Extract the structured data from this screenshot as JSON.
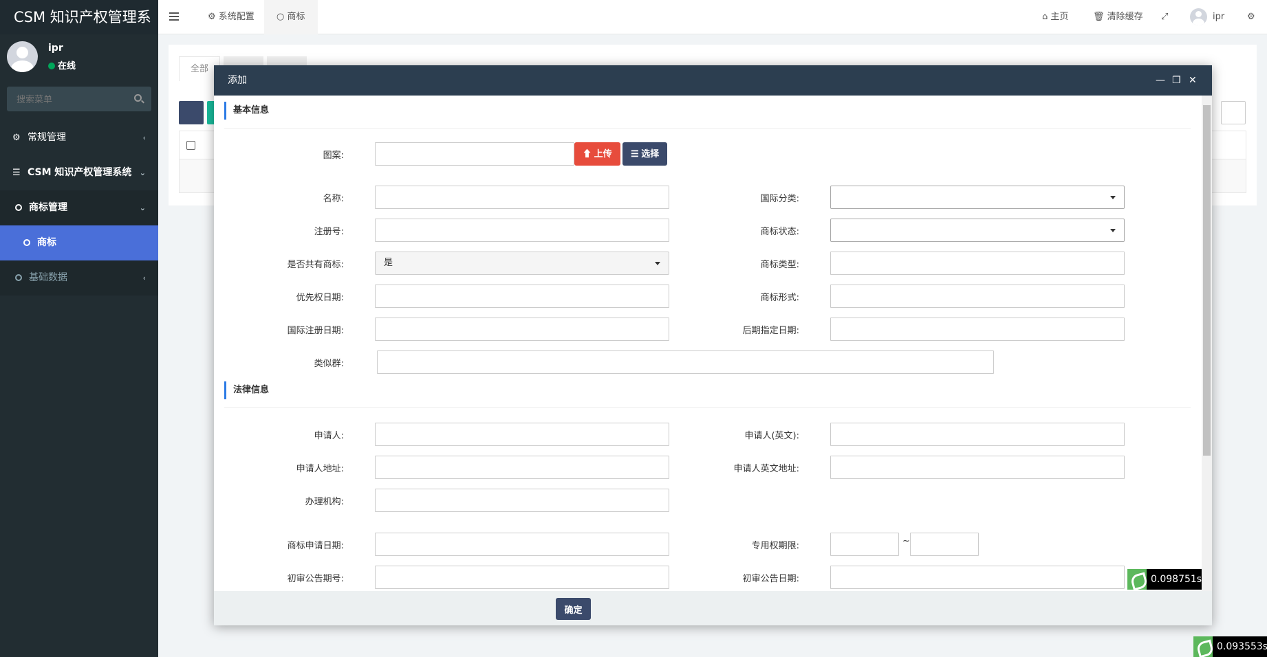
{
  "app": {
    "logo": "CSM 知识产权管理系"
  },
  "user": {
    "name": "ipr",
    "status": "在线"
  },
  "sidebar": {
    "search_placeholder": "搜索菜单",
    "items": [
      {
        "label": "常规管理",
        "icon": "cogs-icon",
        "state": "collapsed"
      },
      {
        "label": "CSM 知识产权管理系统",
        "icon": "list-icon",
        "state": "expanded"
      },
      {
        "label": "商标管理",
        "icon": "circle-icon",
        "state": "expanded"
      },
      {
        "label": "商标",
        "icon": "circle-icon",
        "state": "active"
      },
      {
        "label": "基础数据",
        "icon": "circle-icon",
        "state": "collapsed"
      }
    ]
  },
  "header": {
    "tabs": [
      {
        "label": "系统配置",
        "icon": "gear-icon"
      },
      {
        "label": "商标",
        "icon": "circle-icon"
      }
    ],
    "home": "主页",
    "clear_cache": "清除缓存",
    "user": "ipr"
  },
  "background": {
    "tab_all": "全部"
  },
  "modal": {
    "title": "添加",
    "submit": "确定",
    "sections": {
      "basic": "基本信息",
      "legal": "法律信息"
    },
    "fields": {
      "pattern": "图案:",
      "upload": "上传",
      "choose": "选择",
      "name": "名称:",
      "intl_class": "国际分类:",
      "reg_no": "注册号:",
      "tm_status": "商标状态:",
      "shared": "是否共有商标:",
      "shared_value": "是",
      "tm_type": "商标类型:",
      "priority_date": "优先权日期:",
      "tm_form": "商标形式:",
      "intl_reg_date": "国际注册日期:",
      "later_date": "后期指定日期:",
      "similar_group": "类似群:",
      "applicant": "申请人:",
      "applicant_en": "申请人(英文):",
      "applicant_addr": "申请人地址:",
      "applicant_addr_en": "申请人英文地址:",
      "agency": "办理机构:",
      "apply_date": "商标申请日期:",
      "exclusive_period": "专用权期限:",
      "period_sep": "~",
      "prelim_no": "初审公告期号:",
      "prelim_date": "初审公告日期:"
    }
  },
  "perf": {
    "inner": "0.098751s",
    "outer": "0.093553s"
  },
  "colors": {
    "sidebar": "#222d32",
    "active": "#4a6fd9",
    "modal_head": "#2c3e50",
    "upload": "#e74c3c",
    "choose": "#3b4a6b"
  }
}
